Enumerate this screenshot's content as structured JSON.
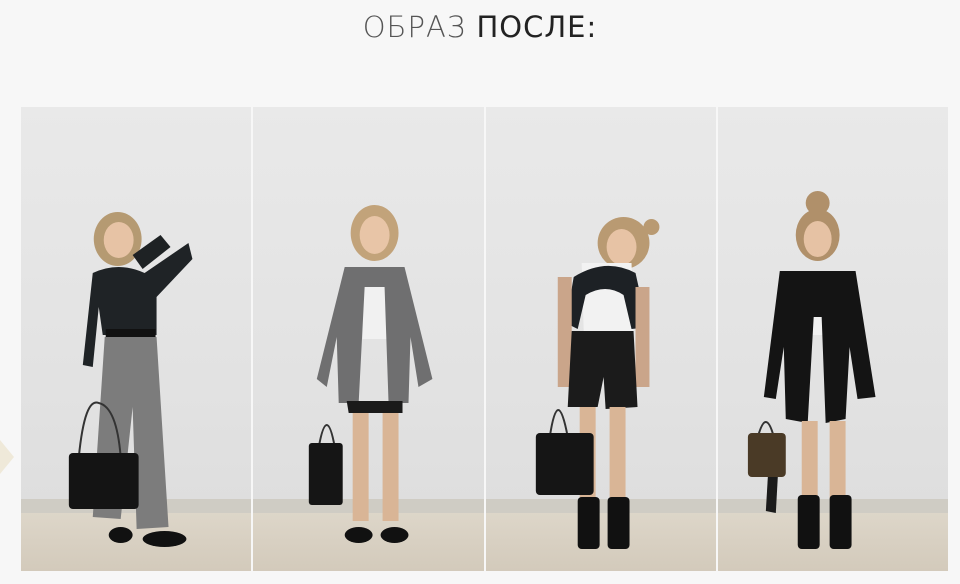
{
  "header": {
    "title_part1": "ОБРАЗ",
    "title_part2": "ПОСЛЕ:"
  },
  "gallery": {
    "photos": [
      {
        "outfit": "black-longsleeve-grey-trousers"
      },
      {
        "outfit": "grey-blazer-black-shorts"
      },
      {
        "outfit": "white-tank-black-shorts"
      },
      {
        "outfit": "black-blazer-black-shorts"
      }
    ]
  },
  "colors": {
    "background": "#f7f7f7",
    "wall": "#e6e6e6",
    "floor": "#d6cdbd",
    "text": "#333333"
  }
}
